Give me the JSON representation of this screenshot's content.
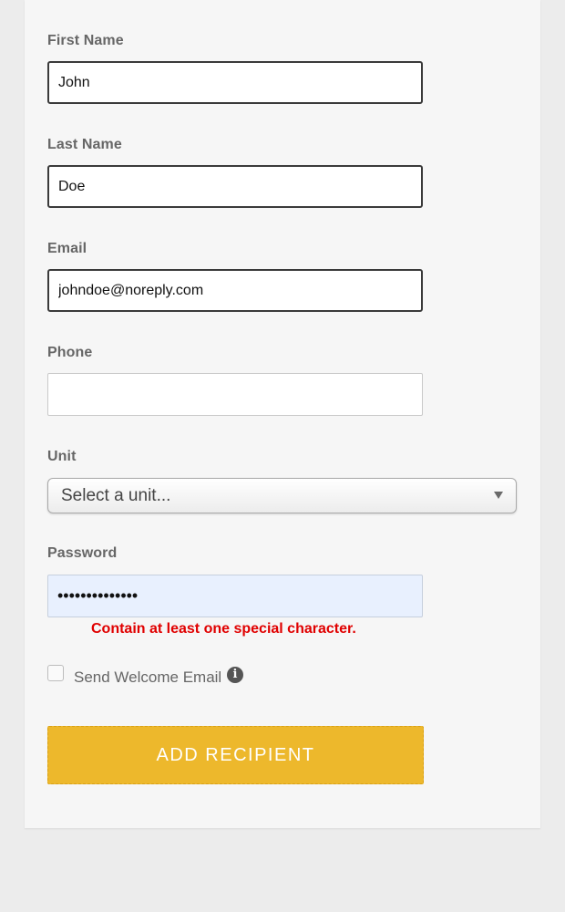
{
  "form": {
    "first_name": {
      "label": "First Name",
      "value": "John"
    },
    "last_name": {
      "label": "Last Name",
      "value": "Doe"
    },
    "email": {
      "label": "Email",
      "value": "johndoe@noreply.com"
    },
    "phone": {
      "label": "Phone",
      "value": ""
    },
    "unit": {
      "label": "Unit",
      "selected": "Select a unit..."
    },
    "password": {
      "label": "Password",
      "masked_value": "••••••••••••••",
      "error": "Contain at least one special character."
    },
    "welcome_email": {
      "label": "Send Welcome Email",
      "checked": false,
      "info_icon": "info-circle-icon"
    },
    "submit_label": "ADD RECIPIENT"
  },
  "colors": {
    "accent": "#edb82c",
    "error": "#e00000",
    "autofill": "#e8f0fe"
  }
}
